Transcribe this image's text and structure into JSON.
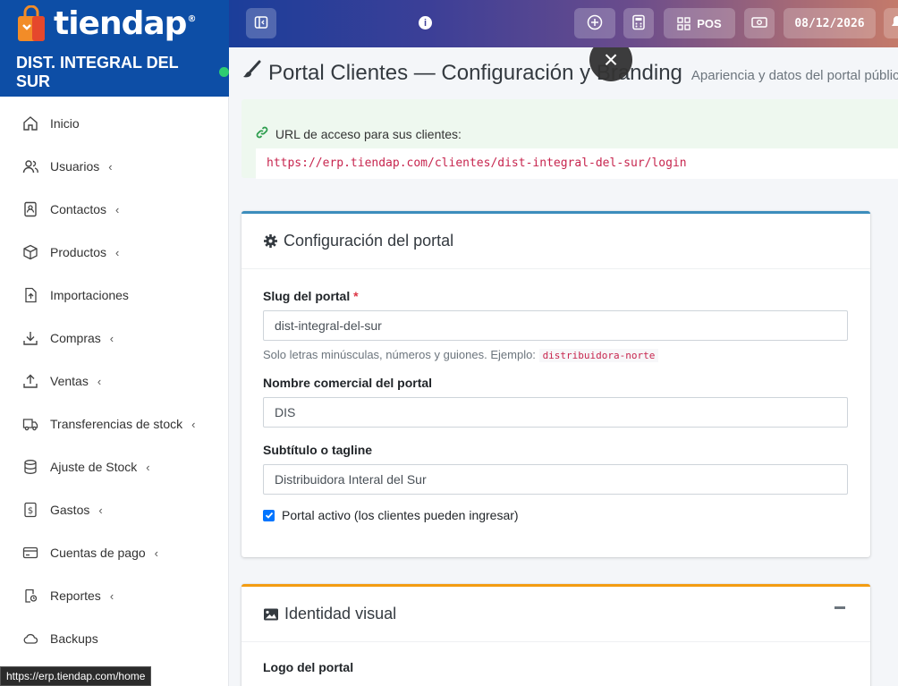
{
  "brand": {
    "name": "tiendap",
    "registered": "®"
  },
  "company": {
    "name": "DIST. INTEGRAL DEL SUR"
  },
  "topbar": {
    "pos_label": "POS",
    "date": "08/12/2026"
  },
  "sidebar": {
    "items": [
      {
        "label": "Inicio",
        "icon": "home-icon",
        "has_children": false
      },
      {
        "label": "Usuarios",
        "icon": "users-icon",
        "has_children": true
      },
      {
        "label": "Contactos",
        "icon": "address-book-icon",
        "has_children": true
      },
      {
        "label": "Productos",
        "icon": "box-icon",
        "has_children": true
      },
      {
        "label": "Importaciones",
        "icon": "file-import-icon",
        "has_children": false
      },
      {
        "label": "Compras",
        "icon": "download-icon",
        "has_children": true
      },
      {
        "label": "Ventas",
        "icon": "upload-icon",
        "has_children": true
      },
      {
        "label": "Transferencias de stock",
        "icon": "truck-icon",
        "has_children": true
      },
      {
        "label": "Ajuste de Stock",
        "icon": "database-icon",
        "has_children": true
      },
      {
        "label": "Gastos",
        "icon": "dollar-file-icon",
        "has_children": true
      },
      {
        "label": "Cuentas de pago",
        "icon": "credit-card-icon",
        "has_children": true
      },
      {
        "label": "Reportes",
        "icon": "report-icon",
        "has_children": true
      },
      {
        "label": "Backups",
        "icon": "cloud-icon",
        "has_children": false
      }
    ],
    "chevron": "‹"
  },
  "status_bar": {
    "url": "https://erp.tiendap.com/home"
  },
  "page": {
    "title": "Portal Clientes — Configuración y Branding",
    "subtitle": "Apariencia y datos del portal público"
  },
  "access_url": {
    "label": "URL de acceso para sus clientes:",
    "url": "https://erp.tiendap.com/clientes/dist-integral-del-sur/login"
  },
  "config_card": {
    "title": "Configuración del portal",
    "slug_label": "Slug del portal",
    "required_mark": "*",
    "slug_value": "dist-integral-del-sur",
    "slug_help": "Solo letras minúsculas, números y guiones. Ejemplo:",
    "slug_example": "distribuidora-norte",
    "name_label": "Nombre comercial del portal",
    "name_value": "DIS",
    "tagline_label": "Subtítulo o tagline",
    "tagline_value": "Distribuidora Interal del Sur",
    "active_label": "Portal activo (los clientes pueden ingresar)",
    "active_checked": true
  },
  "visual_card": {
    "title": "Identidad visual",
    "logo_label": "Logo del portal"
  },
  "colors": {
    "primary": "#0d4ea6",
    "accent_blue": "#3c8dbc",
    "accent_orange": "#f39c12",
    "success": "#2ecc71"
  }
}
